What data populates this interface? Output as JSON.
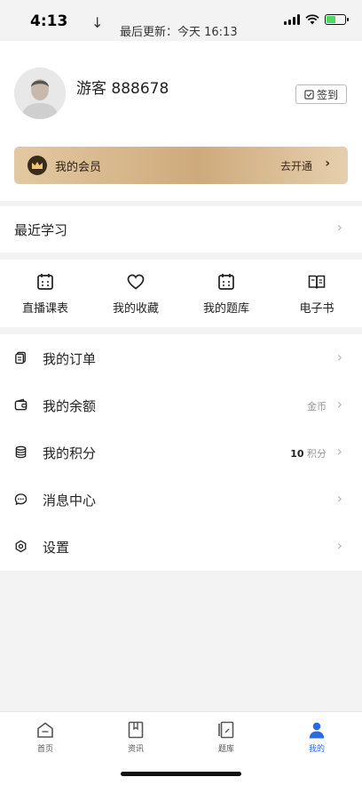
{
  "status_bar": {
    "time": "4:13",
    "update_text": "最后更新：今天 16:13",
    "battery_level": 0.5
  },
  "profile": {
    "username": "游客 888678",
    "checkin_label": "签到"
  },
  "vip": {
    "title": "我的会员",
    "action": "去开通"
  },
  "recent": {
    "title": "最近学习"
  },
  "shortcuts": [
    {
      "label": "直播课表",
      "icon": "calendar-icon"
    },
    {
      "label": "我的收藏",
      "icon": "heart-icon"
    },
    {
      "label": "我的题库",
      "icon": "calendar-grid-icon"
    },
    {
      "label": "电子书",
      "icon": "book-icon"
    }
  ],
  "menu": [
    {
      "label": "我的订单",
      "icon": "orders-icon"
    },
    {
      "label": "我的余额",
      "icon": "wallet-icon",
      "value": "金币"
    },
    {
      "label": "我的积分",
      "icon": "coins-icon",
      "value_number": "10",
      "value_unit": "积分"
    },
    {
      "label": "消息中心",
      "icon": "message-icon"
    },
    {
      "label": "设置",
      "icon": "settings-icon"
    }
  ],
  "tabs": [
    {
      "label": "首页",
      "icon": "home-icon"
    },
    {
      "label": "资讯",
      "icon": "bookmark-icon"
    },
    {
      "label": "题库",
      "icon": "question-bank-icon"
    },
    {
      "label": "我的",
      "icon": "user-icon",
      "active": true
    }
  ],
  "colors": {
    "accent": "#2b6be0",
    "vip_gold": "#ceaa7b",
    "background": "#f3f3f3"
  }
}
